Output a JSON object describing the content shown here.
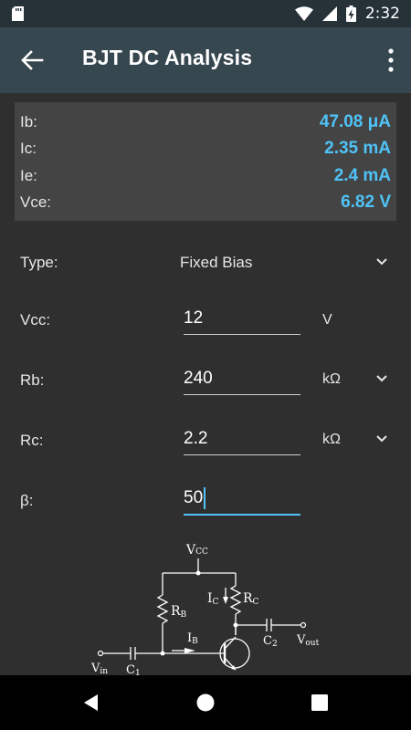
{
  "status_bar": {
    "time": "2:32",
    "icons": [
      "sd-card-icon",
      "wifi-icon",
      "signal-icon",
      "battery-charging-icon"
    ]
  },
  "app_bar": {
    "title": "BJT DC Analysis",
    "back_icon": "arrow-back-icon",
    "menu_icon": "more-vert-icon"
  },
  "results": [
    {
      "label": "Ib:",
      "value": "47.08 μA"
    },
    {
      "label": "Ic:",
      "value": "2.35 mA"
    },
    {
      "label": "Ie:",
      "value": "2.4 mA"
    },
    {
      "label": "Vce:",
      "value": "6.82 V"
    }
  ],
  "form": {
    "type_label": "Type:",
    "type_value": "Fixed Bias",
    "vcc_label": "Vcc:",
    "vcc_value": "12",
    "vcc_unit": "V",
    "rb_label": "Rb:",
    "rb_value": "240",
    "rb_unit": "kΩ",
    "rc_label": "Rc:",
    "rc_value": "2.2",
    "rc_unit": "kΩ",
    "beta_label": "β:",
    "beta_value": "50"
  },
  "circuit": {
    "vcc": "V",
    "vcc_sub": "CC",
    "rb": "R",
    "rb_sub": "B",
    "rc": "R",
    "rc_sub": "C",
    "ic": "I",
    "ic_sub": "C",
    "ib": "I",
    "ib_sub": "B",
    "c2": "C",
    "c2_sub": "2",
    "c1": "C",
    "c1_sub": "1",
    "vout": "V",
    "vout_sub": "out",
    "vin": "V",
    "vin_sub": "in"
  },
  "colors": {
    "accent": "#4fc3f7",
    "app_bar": "#37474f",
    "status_bar": "#263238",
    "background": "#2f2f2f",
    "panel": "#444444"
  }
}
